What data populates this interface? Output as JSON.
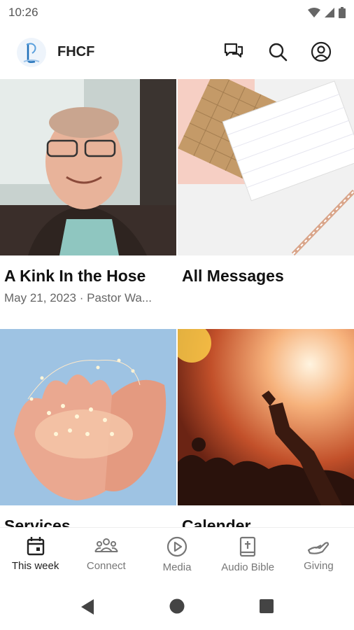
{
  "status": {
    "time": "10:26"
  },
  "app": {
    "title": "FHCF"
  },
  "cards": [
    {
      "title": "A Kink In the Hose",
      "subtitle": "May 21, 2023 · Pastor Wa..."
    },
    {
      "title": "All Messages",
      "subtitle": ""
    },
    {
      "title": "Services",
      "subtitle": ""
    },
    {
      "title": "Calender",
      "subtitle": ""
    }
  ],
  "nav": {
    "items": [
      {
        "label": "This week",
        "icon": "calendar-icon",
        "active": true
      },
      {
        "label": "Connect",
        "icon": "people-icon"
      },
      {
        "label": "Media",
        "icon": "play-icon"
      },
      {
        "label": "Audio Bible",
        "icon": "bible-icon"
      },
      {
        "label": "Giving",
        "icon": "giving-icon"
      }
    ]
  },
  "colors": {
    "accent": "#1e6fb8",
    "text": "#111111",
    "muted": "#777777"
  }
}
